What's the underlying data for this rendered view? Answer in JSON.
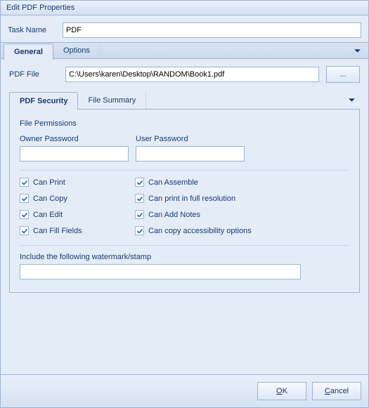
{
  "title": "Edit PDF Properties",
  "taskName": {
    "label": "Task Name",
    "value": "PDF"
  },
  "tabs": {
    "main": [
      "General",
      "Options"
    ],
    "inner": [
      "PDF Security",
      "File Summary"
    ]
  },
  "pdfFile": {
    "label": "PDF File",
    "value": "C:\\Users\\karen\\Desktop\\RANDOM\\Book1.pdf",
    "browseLabel": "..."
  },
  "security": {
    "sectionTitle": "File Permissions",
    "ownerPassword": {
      "label": "Owner Password",
      "value": ""
    },
    "userPassword": {
      "label": "User Password",
      "value": ""
    },
    "permissions": [
      {
        "label": "Can Print",
        "checked": true
      },
      {
        "label": "Can Assemble",
        "checked": true
      },
      {
        "label": "Can Copy",
        "checked": true
      },
      {
        "label": "Can print in full resolution",
        "checked": true
      },
      {
        "label": "Can Edit",
        "checked": true
      },
      {
        "label": "Can Add Notes",
        "checked": true
      },
      {
        "label": "Can Fill Fields",
        "checked": true
      },
      {
        "label": "Can copy accessibility options",
        "checked": true
      }
    ],
    "watermark": {
      "label": "Include the following watermark/stamp",
      "value": ""
    }
  },
  "buttons": {
    "okU": "O",
    "okRest": "K",
    "cancelU": "C",
    "cancelRest": "ancel"
  }
}
